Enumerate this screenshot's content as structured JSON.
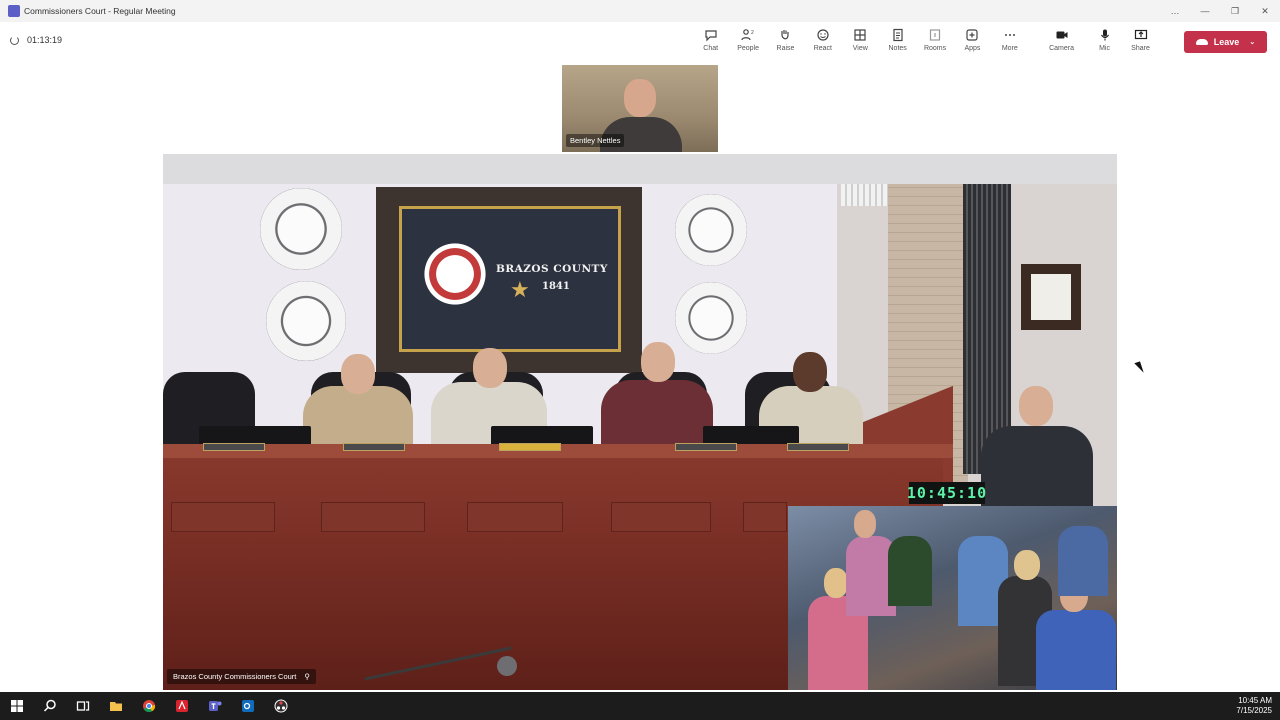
{
  "window": {
    "title": "Commissioners Court - Regular Meeting",
    "controls": [
      "…",
      "—",
      "❐",
      "✕"
    ]
  },
  "toolbar": {
    "elapsed": "01:13:19",
    "items": [
      {
        "label": "Chat",
        "icon": "chat-icon"
      },
      {
        "label": "People",
        "icon": "people-icon",
        "count": "2"
      },
      {
        "label": "Raise",
        "icon": "raise-hand-icon"
      },
      {
        "label": "React",
        "icon": "react-icon"
      },
      {
        "label": "View",
        "icon": "view-icon"
      },
      {
        "label": "Notes",
        "icon": "notes-icon"
      },
      {
        "label": "Rooms",
        "icon": "rooms-icon"
      },
      {
        "label": "Apps",
        "icon": "apps-icon"
      },
      {
        "label": "More",
        "icon": "more-icon"
      }
    ],
    "media": [
      {
        "label": "Camera",
        "icon": "camera-icon"
      },
      {
        "label": "Mic",
        "icon": "mic-icon"
      },
      {
        "label": "Share",
        "icon": "share-icon"
      }
    ],
    "leave_label": "Leave"
  },
  "participants": {
    "thumbnail_name": "Bentley Nettles",
    "main_video_name": "Brazos County Commissioners Court"
  },
  "room": {
    "flag_line1": "BRAZOS COUNTY",
    "flag_line2": "1841",
    "clock": "10:45:10"
  },
  "taskbar": {
    "time": "10:45 AM",
    "date": "7/15/2025",
    "apps": [
      "start-icon",
      "search-icon",
      "task-view-icon",
      "file-explorer-icon",
      "chrome-icon",
      "acrobat-icon",
      "teams-icon",
      "outlook-icon",
      "obs-icon"
    ]
  }
}
